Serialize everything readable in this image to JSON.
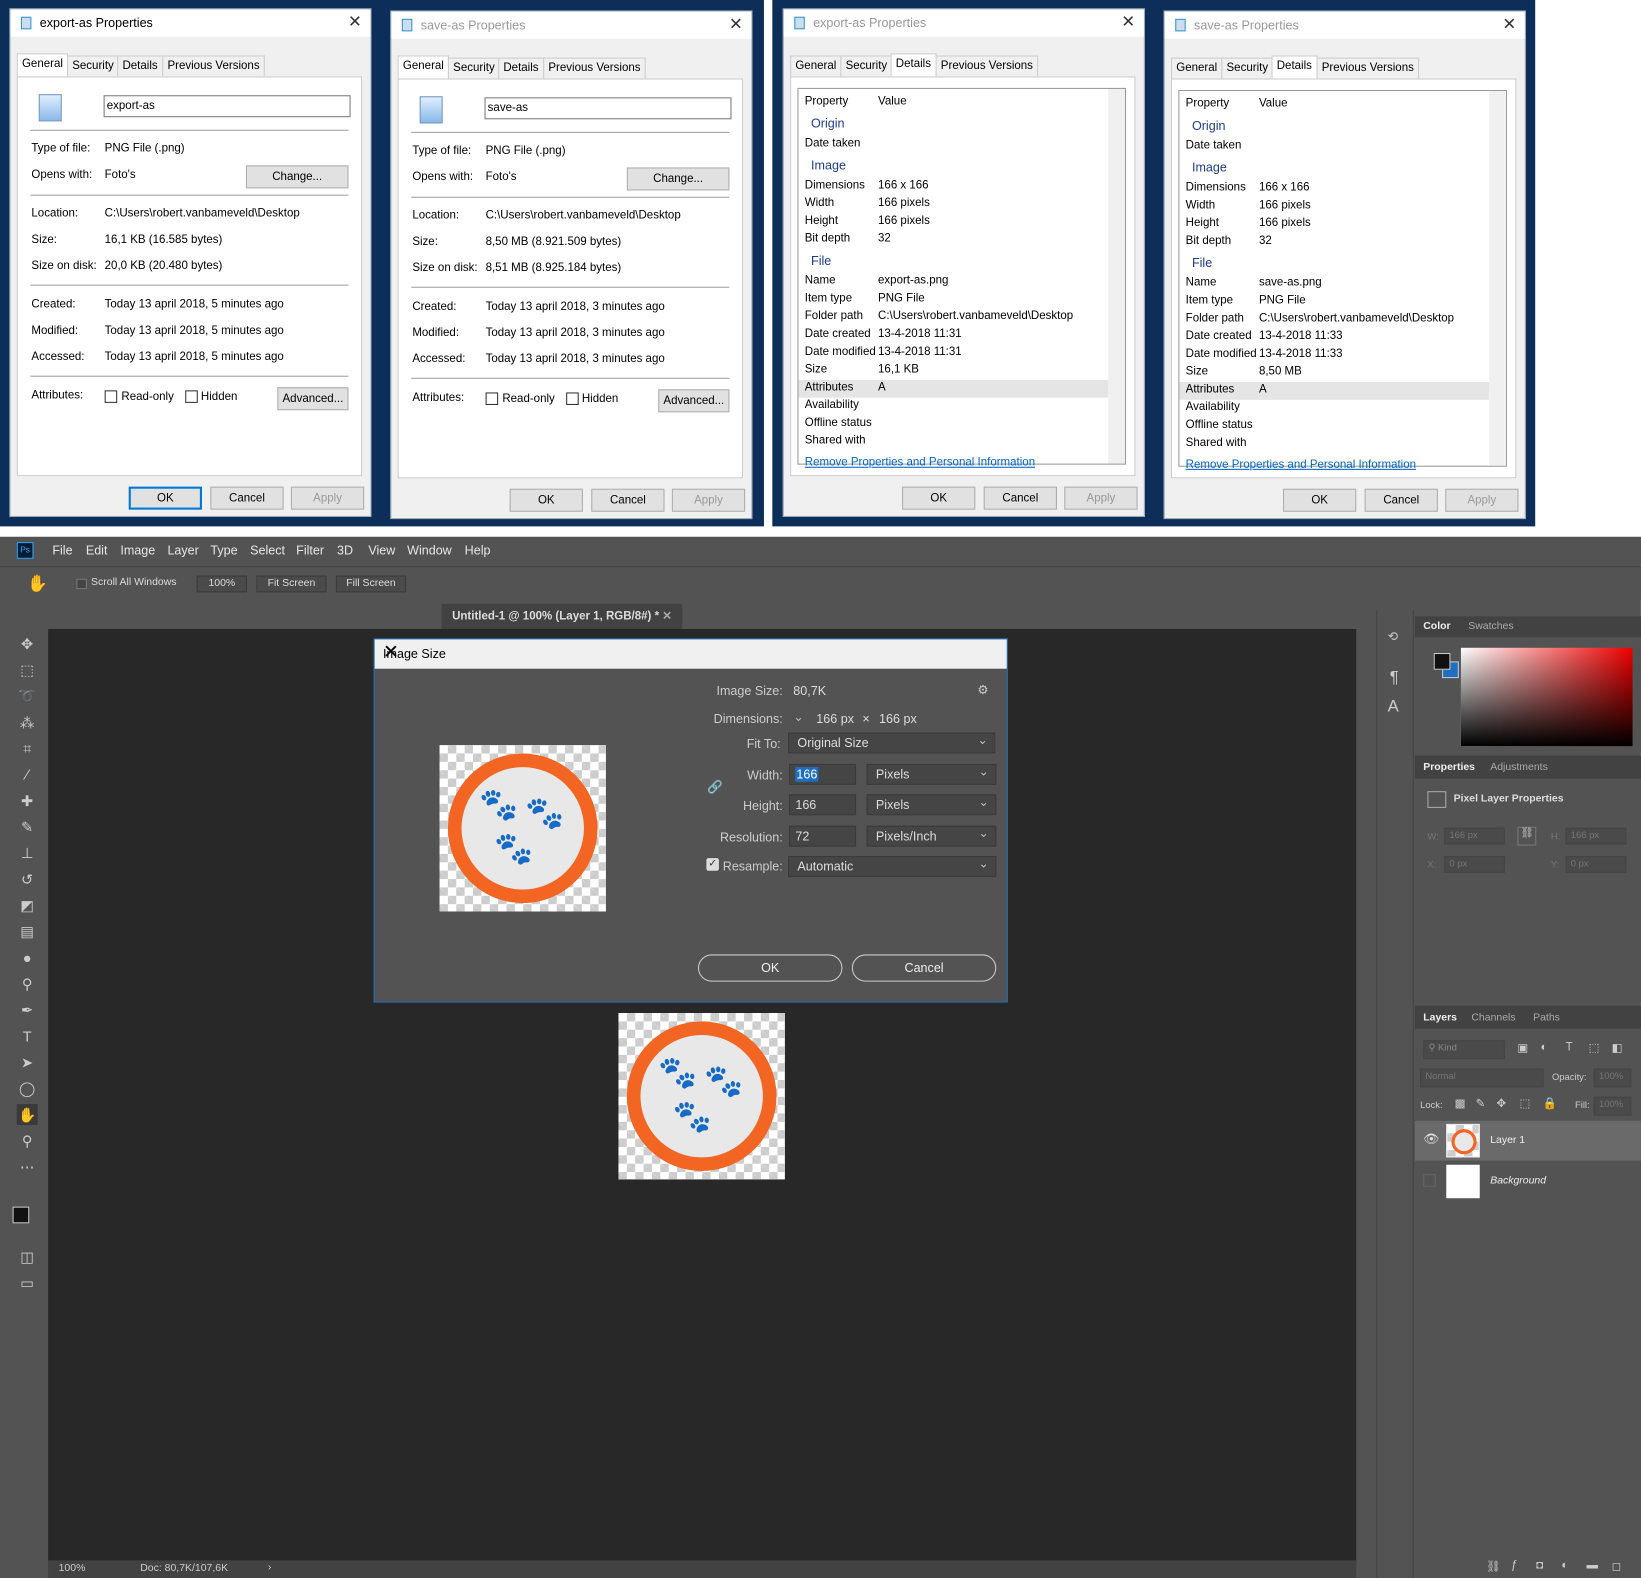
{
  "win1": {
    "title": "export-as Properties",
    "tabs": [
      "General",
      "Security",
      "Details",
      "Previous Versions"
    ],
    "name": "export-as",
    "type_label": "Type of file:",
    "type_value": "PNG File (.png)",
    "opens_label": "Opens with:",
    "opens_value": "Foto's",
    "change_btn": "Change...",
    "location_label": "Location:",
    "location_value": "C:\\Users\\robert.vanbameveld\\Desktop",
    "size_label": "Size:",
    "size_value": "16,1 KB (16.585 bytes)",
    "disk_label": "Size on disk:",
    "disk_value": "20,0 KB (20.480 bytes)",
    "created_label": "Created:",
    "created_value": "Today 13 april 2018, 5 minutes ago",
    "modified_label": "Modified:",
    "modified_value": "Today 13 april 2018, 5 minutes ago",
    "accessed_label": "Accessed:",
    "accessed_value": "Today 13 april 2018, 5 minutes ago",
    "attr_label": "Attributes:",
    "readonly": "Read-only",
    "hidden": "Hidden",
    "advanced": "Advanced...",
    "ok": "OK",
    "cancel": "Cancel",
    "apply": "Apply"
  },
  "win2": {
    "title": "save-as Properties",
    "tabs": [
      "General",
      "Security",
      "Details",
      "Previous Versions"
    ],
    "name": "save-as",
    "type_label": "Type of file:",
    "type_value": "PNG File (.png)",
    "opens_label": "Opens with:",
    "opens_value": "Foto's",
    "change_btn": "Change...",
    "location_label": "Location:",
    "location_value": "C:\\Users\\robert.vanbameveld\\Desktop",
    "size_label": "Size:",
    "size_value": "8,50 MB (8.921.509 bytes)",
    "disk_label": "Size on disk:",
    "disk_value": "8,51 MB (8.925.184 bytes)",
    "created_label": "Created:",
    "created_value": "Today 13 april 2018, 3 minutes ago",
    "modified_label": "Modified:",
    "modified_value": "Today 13 april 2018, 3 minutes ago",
    "accessed_label": "Accessed:",
    "accessed_value": "Today 13 april 2018, 3 minutes ago",
    "attr_label": "Attributes:",
    "readonly": "Read-only",
    "hidden": "Hidden",
    "advanced": "Advanced...",
    "ok": "OK",
    "cancel": "Cancel",
    "apply": "Apply"
  },
  "win3": {
    "title": "export-as Properties",
    "tabs": [
      "General",
      "Security",
      "Details",
      "Previous Versions"
    ],
    "col_property": "Property",
    "col_value": "Value",
    "g_origin": "Origin",
    "g_image": "Image",
    "g_file": "File",
    "rows": [
      [
        "Date taken",
        ""
      ],
      [
        "Dimensions",
        "166 x 166"
      ],
      [
        "Width",
        "166 pixels"
      ],
      [
        "Height",
        "166 pixels"
      ],
      [
        "Bit depth",
        "32"
      ],
      [
        "Name",
        "export-as.png"
      ],
      [
        "Item type",
        "PNG File"
      ],
      [
        "Folder path",
        "C:\\Users\\robert.vanbameveld\\Desktop"
      ],
      [
        "Date created",
        "13-4-2018 11:31"
      ],
      [
        "Date modified",
        "13-4-2018 11:31"
      ],
      [
        "Size",
        "16,1 KB"
      ],
      [
        "Attributes",
        "A"
      ],
      [
        "Availability",
        ""
      ],
      [
        "Offline status",
        ""
      ],
      [
        "Shared with",
        ""
      ]
    ],
    "link": "Remove Properties and Personal Information",
    "ok": "OK",
    "cancel": "Cancel",
    "apply": "Apply"
  },
  "win4": {
    "title": "save-as Properties",
    "tabs": [
      "General",
      "Security",
      "Details",
      "Previous Versions"
    ],
    "col_property": "Property",
    "col_value": "Value",
    "g_origin": "Origin",
    "g_image": "Image",
    "g_file": "File",
    "rows": [
      [
        "Date taken",
        ""
      ],
      [
        "Dimensions",
        "166 x 166"
      ],
      [
        "Width",
        "166 pixels"
      ],
      [
        "Height",
        "166 pixels"
      ],
      [
        "Bit depth",
        "32"
      ],
      [
        "Name",
        "save-as.png"
      ],
      [
        "Item type",
        "PNG File"
      ],
      [
        "Folder path",
        "C:\\Users\\robert.vanbameveld\\Desktop"
      ],
      [
        "Date created",
        "13-4-2018 11:33"
      ],
      [
        "Date modified",
        "13-4-2018 11:33"
      ],
      [
        "Size",
        "8,50 MB"
      ],
      [
        "Attributes",
        "A"
      ],
      [
        "Availability",
        ""
      ],
      [
        "Offline status",
        ""
      ],
      [
        "Shared with",
        ""
      ]
    ],
    "link": "Remove Properties and Personal Information",
    "ok": "OK",
    "cancel": "Cancel",
    "apply": "Apply"
  },
  "ps": {
    "logo": "Ps",
    "menu": [
      "File",
      "Edit",
      "Image",
      "Layer",
      "Type",
      "Select",
      "Filter",
      "3D",
      "View",
      "Window",
      "Help"
    ],
    "scroll_all": "Scroll All Windows",
    "zoom_btn": "100%",
    "fit_screen": "Fit Screen",
    "fill_screen": "Fill Screen",
    "doc_tab": "Untitled-1 @ 100% (Layer 1, RGB/8#) *",
    "status_zoom": "100%",
    "status_doc": "Doc: 80,7K/107,6K",
    "dialog": {
      "title": "Image Size",
      "image_size_label": "Image Size:",
      "image_size_value": "80,7K",
      "dimensions_label": "Dimensions:",
      "dim_w": "166 px",
      "dim_x": "×",
      "dim_h": "166 px",
      "fit_label": "Fit To:",
      "fit_value": "Original Size",
      "width_label": "Width:",
      "width_value": "166",
      "width_unit": "Pixels",
      "height_label": "Height:",
      "height_value": "166",
      "height_unit": "Pixels",
      "res_label": "Resolution:",
      "res_value": "72",
      "res_unit": "Pixels/Inch",
      "resample_label": "Resample:",
      "resample_value": "Automatic",
      "ok": "OK",
      "cancel": "Cancel"
    },
    "panels": {
      "color": "Color",
      "swatches": "Swatches",
      "properties": "Properties",
      "adjustments": "Adjustments",
      "pixel_layer": "Pixel Layer Properties",
      "w_label": "W:",
      "w_value": "166 px",
      "h_label": "H:",
      "h_value": "166 px",
      "x_label": "X:",
      "x_value": "0 px",
      "y_label": "Y:",
      "y_value": "0 px",
      "layers": "Layers",
      "channels": "Channels",
      "paths": "Paths",
      "kind": "Kind",
      "blend": "Normal",
      "opacity_label": "Opacity:",
      "opacity_value": "100%",
      "lock_label": "Lock:",
      "fill_label": "Fill:",
      "fill_value": "100%",
      "layer1": "Layer 1",
      "background": "Background"
    },
    "colors": {
      "orange": "#f26522",
      "accent": "#1f6fc0"
    }
  }
}
